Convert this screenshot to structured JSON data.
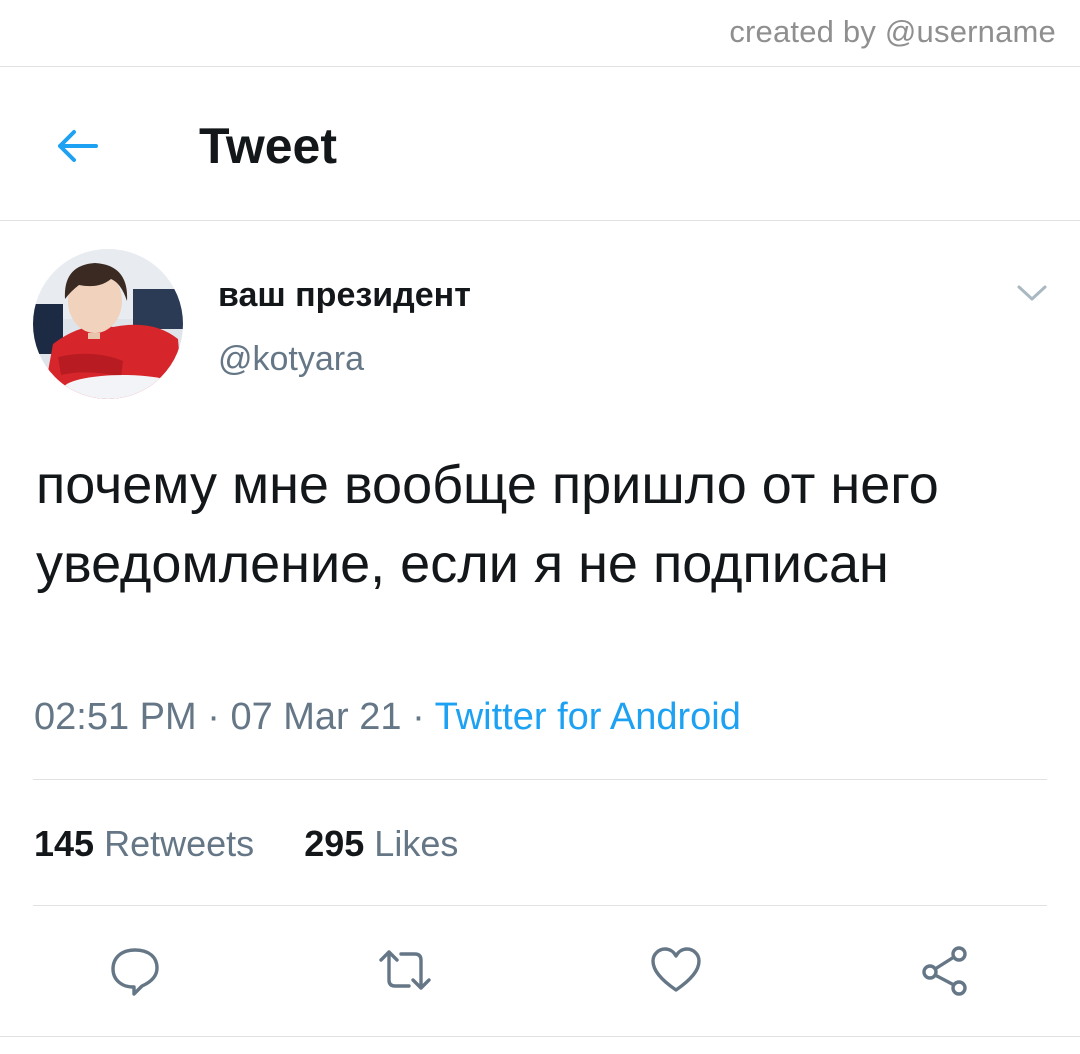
{
  "watermark": "created by @username",
  "header": {
    "title": "Tweet",
    "back_icon": "arrow-left-icon",
    "accent_color": "#1da1f2"
  },
  "tweet": {
    "author_name": "ваш президент",
    "author_handle": "@kotyara",
    "text": "почему мне вообще пришло от него уведомление, если я не подписан",
    "time": "02:51 PM",
    "date": "07 Mar 21",
    "separator": "·",
    "source": "Twitter for Android",
    "stats": {
      "retweets_count": "145",
      "retweets_label": "Retweets",
      "likes_count": "295",
      "likes_label": "Likes"
    }
  },
  "actions": [
    {
      "name": "reply",
      "icon": "comment-icon"
    },
    {
      "name": "retweet",
      "icon": "retweet-icon"
    },
    {
      "name": "like",
      "icon": "heart-icon"
    },
    {
      "name": "share",
      "icon": "share-icon"
    }
  ],
  "colors": {
    "text_primary": "#14171a",
    "text_secondary": "#657786",
    "divider": "#e1e1e1",
    "link": "#1da1f2"
  }
}
